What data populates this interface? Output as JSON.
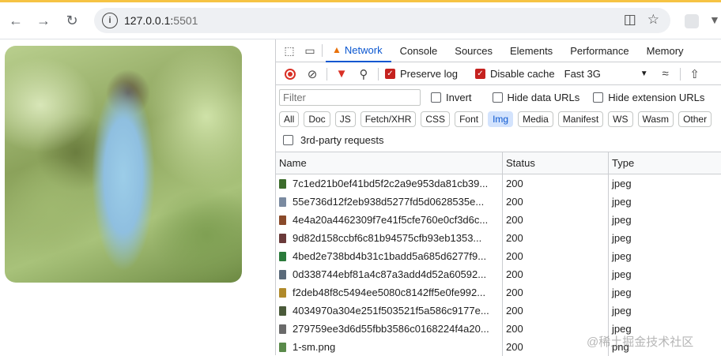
{
  "browser": {
    "url_host": "127.0.0.1:",
    "url_port": "5501"
  },
  "devtools": {
    "tabs": [
      {
        "label": "Network",
        "active": true
      },
      {
        "label": "Console"
      },
      {
        "label": "Sources"
      },
      {
        "label": "Elements"
      },
      {
        "label": "Performance"
      },
      {
        "label": "Memory"
      }
    ],
    "toolbar": {
      "preserve_log": "Preserve log",
      "disable_cache": "Disable cache",
      "throttling": "Fast 3G"
    },
    "filter": {
      "placeholder": "Filter",
      "invert": "Invert",
      "hide_data_urls": "Hide data URLs",
      "hide_extension_urls": "Hide extension URLs"
    },
    "types": [
      "All",
      "Doc",
      "JS",
      "Fetch/XHR",
      "CSS",
      "Font",
      "Img",
      "Media",
      "Manifest",
      "WS",
      "Wasm",
      "Other"
    ],
    "active_type": "Img",
    "third_party": "3rd-party requests",
    "columns": {
      "name": "Name",
      "status": "Status",
      "type": "Type"
    },
    "rows": [
      {
        "name": "7c1ed21b0ef41bd5f2c2a9e953da81cb39...",
        "status": "200",
        "type": "jpeg",
        "thumb": "#3b6b2a"
      },
      {
        "name": "55e736d12f2eb938d5277fd5d0628535e...",
        "status": "200",
        "type": "jpeg",
        "thumb": "#7a8aa0"
      },
      {
        "name": "4e4a20a4462309f7e41f5cfe760e0cf3d6c...",
        "status": "200",
        "type": "jpeg",
        "thumb": "#8a4a2a"
      },
      {
        "name": "9d82d158ccbf6c81b94575cfb93eb1353...",
        "status": "200",
        "type": "jpeg",
        "thumb": "#6a3a3a"
      },
      {
        "name": "4bed2e738bd4b31c1badd5a685d6277f9...",
        "status": "200",
        "type": "jpeg",
        "thumb": "#2a7a3a"
      },
      {
        "name": "0d338744ebf81a4c87a3add4d52a60592...",
        "status": "200",
        "type": "jpeg",
        "thumb": "#5a6a7a"
      },
      {
        "name": "f2deb48f8c5494ee5080c8142ff5e0fe992...",
        "status": "200",
        "type": "jpeg",
        "thumb": "#b08a2a"
      },
      {
        "name": "4034970a304e251f503521f5a586c9177e...",
        "status": "200",
        "type": "jpeg",
        "thumb": "#4a5a3a"
      },
      {
        "name": "279759ee3d6d55fbb3586c0168224f4a20...",
        "status": "200",
        "type": "jpeg",
        "thumb": "#6a6a6a"
      },
      {
        "name": "1-sm.png",
        "status": "200",
        "type": "png",
        "thumb": "#5a8a4a"
      }
    ]
  },
  "watermark": "@稀土掘金技术社区"
}
